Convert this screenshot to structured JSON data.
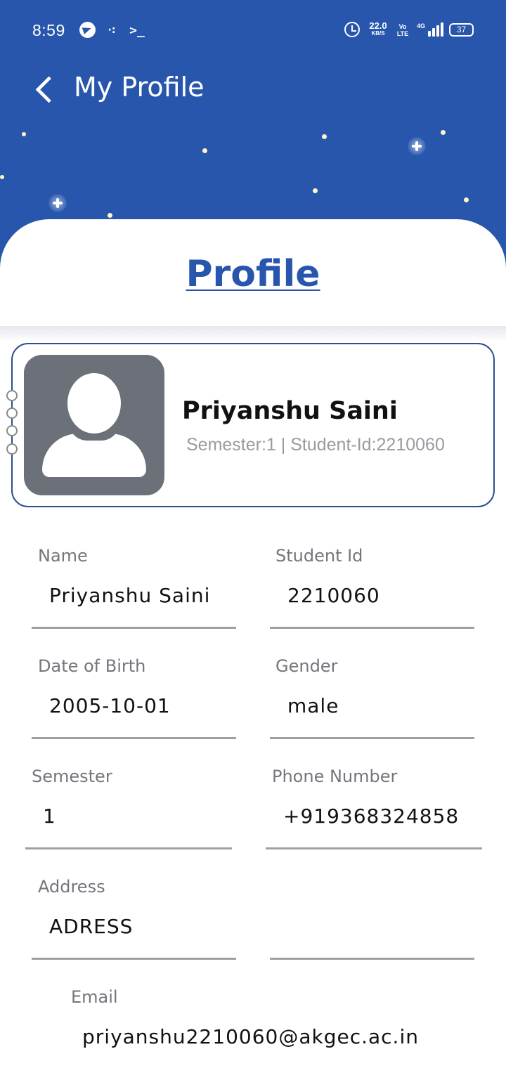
{
  "status_bar": {
    "time": "8:59",
    "dots_glyph": "·:",
    "terminal_glyph": ">_",
    "net_speed_value": "22.0",
    "net_speed_unit": "KB/S",
    "volte": "Vo LTE",
    "network_type": "4G",
    "battery": "37"
  },
  "top_bar": {
    "title": "My Profile"
  },
  "sheet": {
    "title": "Profile"
  },
  "profile_card": {
    "name": "Priyanshu Saini",
    "subtitle": "Semester:1 | Student-Id:2210060"
  },
  "fields": {
    "name": {
      "label": "Name",
      "value": "Priyanshu Saini"
    },
    "student_id": {
      "label": "Student Id",
      "value": "2210060"
    },
    "dob": {
      "label": "Date of Birth",
      "value": "2005-10-01"
    },
    "gender": {
      "label": "Gender",
      "value": "male"
    },
    "semester": {
      "label": "Semester",
      "value": "1"
    },
    "phone": {
      "label": "Phone Number",
      "value": "+919368324858"
    },
    "address": {
      "label": "Address",
      "value": "ADRESS"
    },
    "email": {
      "label": "Email",
      "value": "priyanshu2210060@akgec.ac.in"
    }
  },
  "colors": {
    "header_blue": "#2856ad",
    "title_blue": "#2856ad",
    "card_border": "#2d4f8f",
    "avatar_gray": "#6b7079"
  },
  "icons": [
    "telegram-icon",
    "terminal-icon",
    "alarm-icon",
    "signal-icon",
    "battery-icon",
    "back-arrow-icon",
    "avatar-placeholder-icon"
  ]
}
